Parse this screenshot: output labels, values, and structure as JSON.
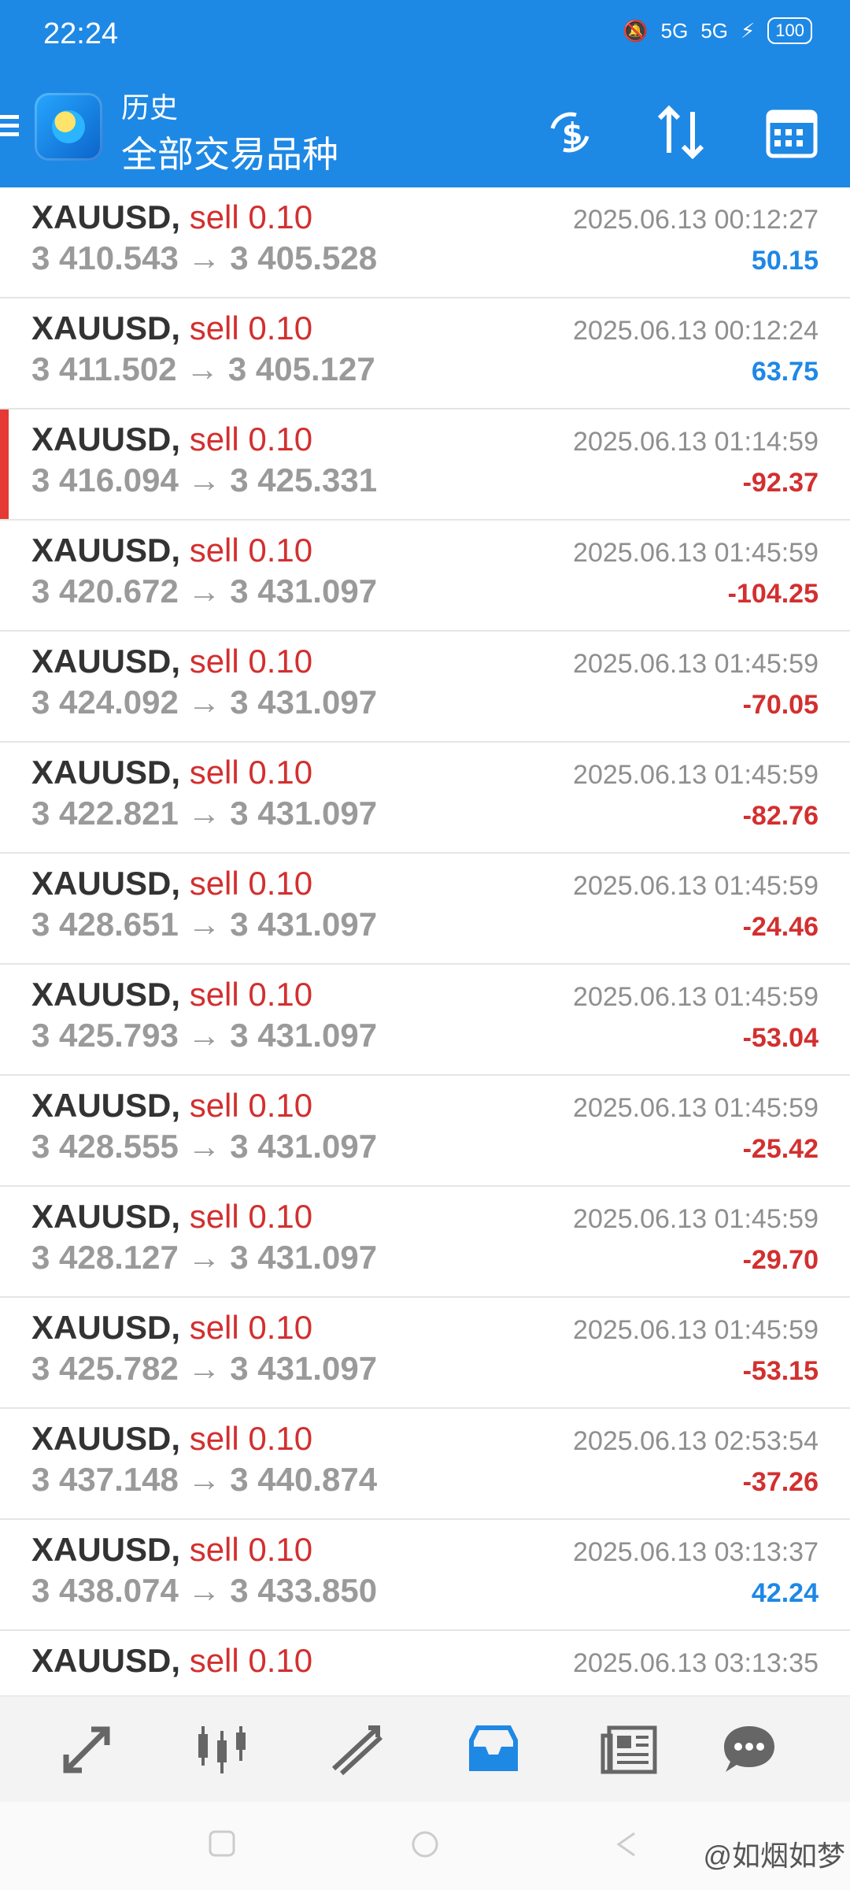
{
  "status": {
    "time": "22:24",
    "signal1": "5G",
    "signal2": "5G",
    "battery": "100"
  },
  "header": {
    "subtitle": "历史",
    "title": "全部交易品种"
  },
  "trades": [
    {
      "symbol": "XAUUSD,",
      "action": "sell 0.10",
      "open": "3 410.543",
      "close": "3 405.528",
      "time": "2025.06.13 00:12:27",
      "profit": "50.15",
      "sign": "pos"
    },
    {
      "symbol": "XAUUSD,",
      "action": "sell 0.10",
      "open": "3 411.502",
      "close": "3 405.127",
      "time": "2025.06.13 00:12:24",
      "profit": "63.75",
      "sign": "pos"
    },
    {
      "symbol": "XAUUSD,",
      "action": "sell 0.10",
      "open": "3 416.094",
      "close": "3 425.331",
      "time": "2025.06.13 01:14:59",
      "profit": "-92.37",
      "sign": "neg"
    },
    {
      "symbol": "XAUUSD,",
      "action": "sell 0.10",
      "open": "3 420.672",
      "close": "3 431.097",
      "time": "2025.06.13 01:45:59",
      "profit": "-104.25",
      "sign": "neg"
    },
    {
      "symbol": "XAUUSD,",
      "action": "sell 0.10",
      "open": "3 424.092",
      "close": "3 431.097",
      "time": "2025.06.13 01:45:59",
      "profit": "-70.05",
      "sign": "neg"
    },
    {
      "symbol": "XAUUSD,",
      "action": "sell 0.10",
      "open": "3 422.821",
      "close": "3 431.097",
      "time": "2025.06.13 01:45:59",
      "profit": "-82.76",
      "sign": "neg"
    },
    {
      "symbol": "XAUUSD,",
      "action": "sell 0.10",
      "open": "3 428.651",
      "close": "3 431.097",
      "time": "2025.06.13 01:45:59",
      "profit": "-24.46",
      "sign": "neg"
    },
    {
      "symbol": "XAUUSD,",
      "action": "sell 0.10",
      "open": "3 425.793",
      "close": "3 431.097",
      "time": "2025.06.13 01:45:59",
      "profit": "-53.04",
      "sign": "neg"
    },
    {
      "symbol": "XAUUSD,",
      "action": "sell 0.10",
      "open": "3 428.555",
      "close": "3 431.097",
      "time": "2025.06.13 01:45:59",
      "profit": "-25.42",
      "sign": "neg"
    },
    {
      "symbol": "XAUUSD,",
      "action": "sell 0.10",
      "open": "3 428.127",
      "close": "3 431.097",
      "time": "2025.06.13 01:45:59",
      "profit": "-29.70",
      "sign": "neg"
    },
    {
      "symbol": "XAUUSD,",
      "action": "sell 0.10",
      "open": "3 425.782",
      "close": "3 431.097",
      "time": "2025.06.13 01:45:59",
      "profit": "-53.15",
      "sign": "neg"
    },
    {
      "symbol": "XAUUSD,",
      "action": "sell 0.10",
      "open": "3 437.148",
      "close": "3 440.874",
      "time": "2025.06.13 02:53:54",
      "profit": "-37.26",
      "sign": "neg"
    },
    {
      "symbol": "XAUUSD,",
      "action": "sell 0.10",
      "open": "3 438.074",
      "close": "3 433.850",
      "time": "2025.06.13 03:13:37",
      "profit": "42.24",
      "sign": "pos"
    },
    {
      "symbol": "XAUUSD,",
      "action": "sell 0.10",
      "open": "",
      "close": "",
      "time": "2025.06.13 03:13:35",
      "profit": "",
      "sign": "pos"
    }
  ],
  "watermark": "@如烟如梦",
  "colors": {
    "primary": "#1E88E5",
    "positive": "#1E88E5",
    "negative": "#D32F2F"
  }
}
